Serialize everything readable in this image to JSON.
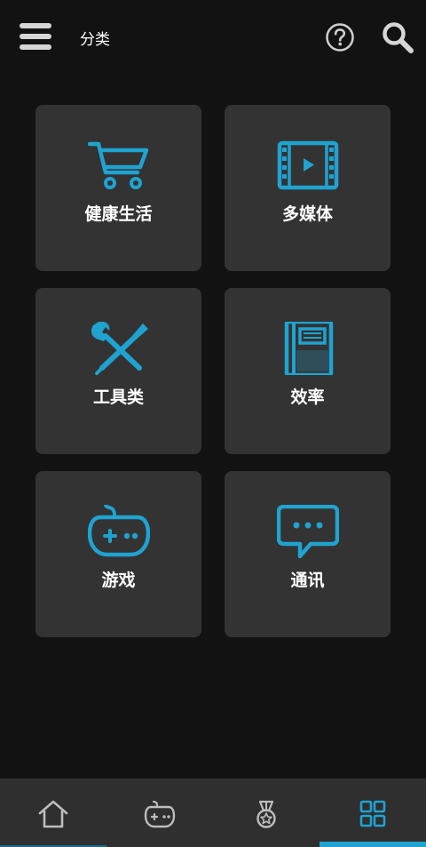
{
  "header": {
    "title": "分类",
    "menu_icon": "hamburger-menu-icon",
    "help_icon": "question-circle-icon",
    "search_icon": "search-icon"
  },
  "categories": [
    {
      "label": "健康生活",
      "icon": "shopping-cart-icon"
    },
    {
      "label": "多媒体",
      "icon": "film-strip-icon"
    },
    {
      "label": "工具类",
      "icon": "tools-icon"
    },
    {
      "label": "效率",
      "icon": "notebook-icon"
    },
    {
      "label": "游戏",
      "icon": "gamepad-icon"
    },
    {
      "label": "通讯",
      "icon": "chat-bubble-icon"
    }
  ],
  "bottom_nav": {
    "items": [
      {
        "icon": "home-icon",
        "selected": false
      },
      {
        "icon": "gamepad-icon",
        "selected": false
      },
      {
        "icon": "medal-icon",
        "selected": false
      },
      {
        "icon": "grid-icon",
        "selected": true
      }
    ]
  },
  "colors": {
    "accent": "#1fa3d1",
    "background": "#121212",
    "tile": "#333333",
    "nav": "#2f2f2f",
    "inactive_icon": "#bdbdbd"
  }
}
